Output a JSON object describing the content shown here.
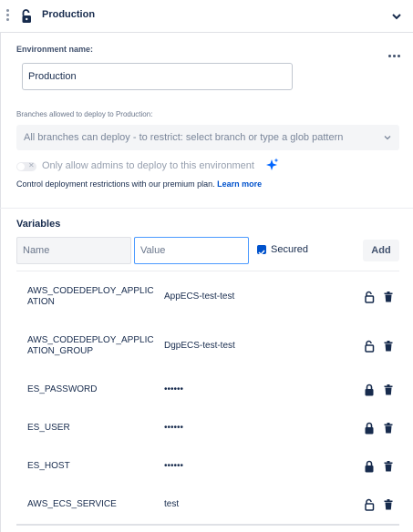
{
  "header": {
    "title": "Production",
    "lock_icon": "unlock-icon",
    "expand_icon": "chevron-down-icon"
  },
  "environment": {
    "name_label": "Environment name:",
    "name_value": "Production",
    "more_icon": "more-horizontal-icon",
    "branches_label": "Branches allowed to deploy to Production:",
    "branches_placeholder": "All branches can deploy - to restrict: select branch or type a glob pattern",
    "admins_only_label": "Only allow admins to deploy to this environment",
    "admins_only_enabled": false,
    "premium_text": "Control deployment restrictions with our premium plan.",
    "learn_more_label": "Learn more"
  },
  "variables": {
    "title": "Variables",
    "name_placeholder": "Name",
    "value_placeholder": "Value",
    "secured_label": "Secured",
    "secured_checked": true,
    "add_label": "Add",
    "rows": [
      {
        "name": "AWS_CODEDEPLOY_APPLICATION",
        "value": "AppECS-test-test",
        "secured": false
      },
      {
        "name": "AWS_CODEDEPLOY_APPLICATION_GROUP",
        "value": "DgpECS-test-test",
        "secured": false
      },
      {
        "name": "ES_PASSWORD",
        "value": "••••••",
        "secured": true
      },
      {
        "name": "ES_USER",
        "value": "••••••",
        "secured": true
      },
      {
        "name": "ES_HOST",
        "value": "••••••",
        "secured": true
      },
      {
        "name": "AWS_ECS_SERVICE",
        "value": "test",
        "secured": false
      }
    ]
  },
  "colors": {
    "accent": "#0052cc",
    "focus": "#4c9aff",
    "text": "#172b4d",
    "muted": "#97a0af"
  }
}
